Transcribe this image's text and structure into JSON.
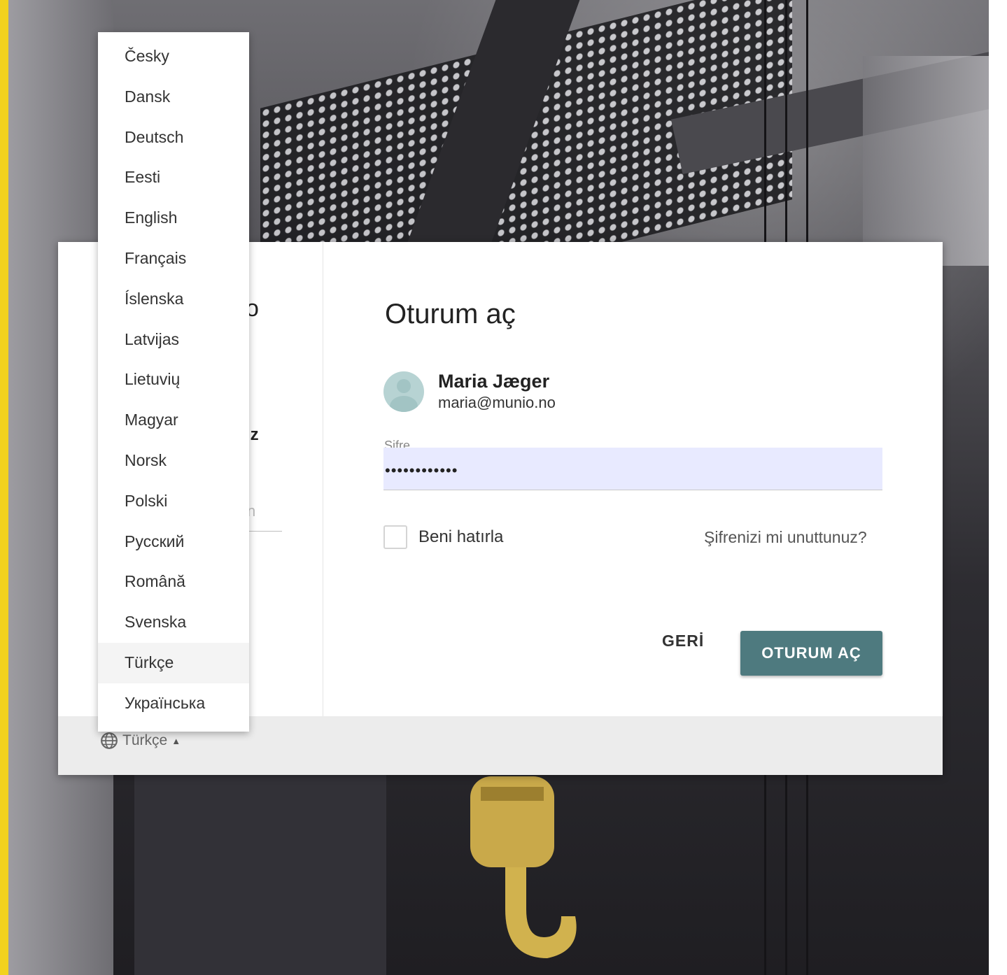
{
  "background": {
    "stripe_color": "#f2d21e"
  },
  "login": {
    "title": "Oturum aç",
    "user": {
      "name": "Maria Jæger",
      "email": "maria@munio.no"
    },
    "password": {
      "label": "Şifre",
      "value": "••••••••••••"
    },
    "remember_label": "Beni hatırla",
    "forgot_link": "Şifrenizi mi unuttunuz?",
    "back_label": "GERİ",
    "submit_label": "OTURUM AÇ",
    "accent_color": "#4e7a7f"
  },
  "left_pane_peek": {
    "title_fragment": "o",
    "subtitle_fragment": "ız",
    "input_fragment": "n"
  },
  "language": {
    "current": "Türkçe",
    "options": [
      "Česky",
      "Dansk",
      "Deutsch",
      "Eesti",
      "English",
      "Français",
      "Íslenska",
      "Latvijas",
      "Lietuvių",
      "Magyar",
      "Norsk",
      "Polski",
      "Русский",
      "Română",
      "Svenska",
      "Türkçe",
      "Українська"
    ],
    "selected_index": 15
  }
}
